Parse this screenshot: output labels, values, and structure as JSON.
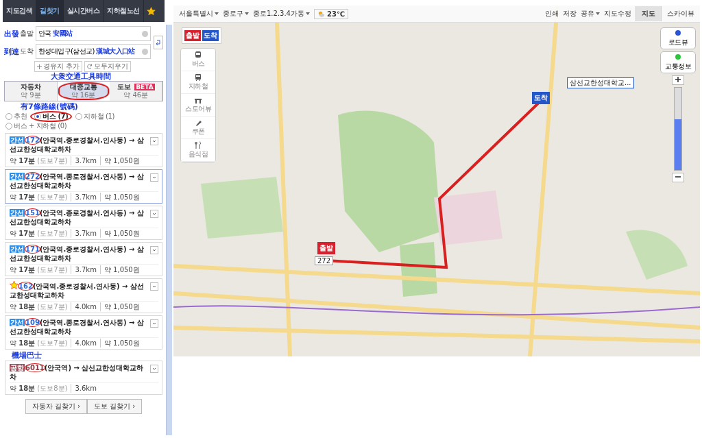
{
  "nav_tabs": [
    {
      "label": "지도검색",
      "selected": false
    },
    {
      "label": "길찾기",
      "selected": true
    },
    {
      "label": "실시간버스",
      "selected": false
    },
    {
      "label": "지하철노선",
      "selected": false
    }
  ],
  "origin": {
    "annotation": "出發",
    "label": "출발",
    "value": "안국",
    "note": "安國站"
  },
  "destination": {
    "annotation": "到達",
    "label": "도착",
    "value": "한성대입구(삼선교)",
    "note": "漢城大入口站"
  },
  "route_buttons": [
    "경유지 추가",
    "모두지우기"
  ],
  "mode_annotation": "大衆交通工具時間",
  "modes": [
    {
      "label": "자동차",
      "time": "약 9분",
      "selected": false,
      "circled": false
    },
    {
      "label": "대중교통",
      "time": "약 16분",
      "selected": true,
      "circled": true
    },
    {
      "label": "도보",
      "badge": "BETA",
      "time": "약 46분",
      "selected": false,
      "circled": false
    }
  ],
  "filter_annotation": "有7條路線(號碼)",
  "filters": [
    {
      "label": "추천",
      "selected": false,
      "circled": false
    },
    {
      "label": "버스 (7)",
      "selected": true,
      "circled": true
    },
    {
      "label": "지하철 (1)",
      "selected": false,
      "circled": false
    },
    {
      "label": "버스 + 지하철 (0)",
      "selected": false,
      "circled": false
    }
  ],
  "routes": [
    {
      "kind": "trunk",
      "badge": "간선",
      "starred": false,
      "number": "172",
      "circled": true,
      "path": "(안국역.종로경찰서.인사동) → 삼선교한성대학교하차",
      "time_prefix": "약",
      "time": "17분",
      "walk": "(도보7분)",
      "distance": "3.7km",
      "fare": "약 1,050원",
      "selected": false
    },
    {
      "kind": "trunk",
      "badge": "간선",
      "starred": false,
      "number": "272",
      "circled": true,
      "path": "(안국역.종로경찰서.연사동) → 삼선교한성대학교하차",
      "time_prefix": "약",
      "time": "17분",
      "walk": "(도보7분)",
      "distance": "3.7km",
      "fare": "약 1,050원",
      "selected": true
    },
    {
      "kind": "trunk",
      "badge": "간선",
      "starred": false,
      "number": "151",
      "circled": true,
      "path": "(안국역.종로경찰서.연사동) → 삼선교한성대학교하차",
      "time_prefix": "약",
      "time": "17분",
      "walk": "(도보7분)",
      "distance": "3.7km",
      "fare": "약 1,050원",
      "selected": false
    },
    {
      "kind": "trunk",
      "badge": "간선",
      "starred": false,
      "number": "171",
      "circled": true,
      "path": "(안국역.종로경찰서.연사동) → 삼선교한성대학교하차",
      "time_prefix": "약",
      "time": "17분",
      "walk": "(도보7분)",
      "distance": "3.7km",
      "fare": "약 1,050원",
      "selected": false
    },
    {
      "kind": "trunk",
      "starred": true,
      "number": "162",
      "circled": true,
      "path": "(안국역.종로경찰서.연사동) → 삼선교한성대학교하차",
      "time_prefix": "약",
      "time": "18분",
      "walk": "(도보7분)",
      "distance": "4.0km",
      "fare": "약 1,050원",
      "selected": false
    },
    {
      "kind": "trunk",
      "badge": "간선",
      "starred": false,
      "number": "109",
      "circled": true,
      "path": "(안국역.종로경찰서.연사동) → 삼선교한성대학교하차",
      "time_prefix": "약",
      "time": "18분",
      "walk": "(도보7분)",
      "distance": "4.0km",
      "fare": "약 1,050원",
      "selected": false
    },
    {
      "kind": "airport",
      "badge": "공항",
      "annotation": "機場巴士",
      "starred": false,
      "number": "6011",
      "circled": true,
      "path": "(안국역) → 삼선교한성대학교하차",
      "time_prefix": "약",
      "time": "18분",
      "walk": "(도보8분)",
      "distance": "3.6km",
      "selected": false
    }
  ],
  "bottom_buttons": [
    "자동차 길찾기 ›",
    "도보 길찾기 ›"
  ],
  "map": {
    "breadcrumb": [
      "서울특별시",
      "종로구",
      "종로1.2.3.4가동"
    ],
    "weather": "23℃",
    "actions": [
      {
        "label": "인쇄",
        "dropdown": false
      },
      {
        "label": "저장",
        "dropdown": false
      },
      {
        "label": "공유",
        "dropdown": true
      },
      {
        "label": "지도수정",
        "dropdown": false
      }
    ],
    "view_tabs": [
      {
        "label": "지도",
        "selected": true
      },
      {
        "label": "스카이뷰",
        "selected": false
      }
    ],
    "flags": [
      "출발",
      "도착"
    ],
    "tools": [
      "버스",
      "지하철",
      "스토어뷰",
      "쿠폰",
      "음식점"
    ],
    "side_buttons": [
      "로드뷰",
      "교통정보"
    ],
    "zoom": {
      "level": 0.62
    },
    "start_marker": "출발",
    "bus_label": "272",
    "end_marker": "도착",
    "station_label": "삼선교한성대학교..."
  }
}
